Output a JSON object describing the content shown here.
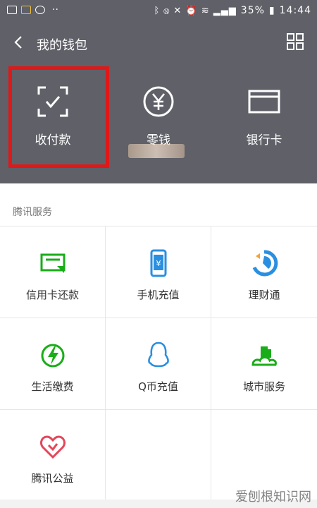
{
  "status_bar": {
    "battery": "35%",
    "time": "14:44",
    "dots": "··",
    "icons": [
      "image-icon",
      "account-icon",
      "wechat-icon",
      "bluetooth-icon",
      "nfc-icon",
      "mute-icon",
      "alarm-icon",
      "wifi-icon",
      "signal-icon",
      "battery-icon"
    ]
  },
  "header": {
    "title": "我的钱包",
    "back_icon": "chevron-left-icon",
    "menu_icon": "grid-icon"
  },
  "wallet_actions": [
    {
      "label": "收付款",
      "icon": "scan-check-icon"
    },
    {
      "label": "零钱",
      "icon": "yuan-circle-icon"
    },
    {
      "label": "银行卡",
      "icon": "card-icon"
    }
  ],
  "services": {
    "title": "腾讯服务",
    "items": [
      {
        "label": "信用卡还款",
        "icon": "credit-card-repay-icon"
      },
      {
        "label": "手机充值",
        "icon": "phone-recharge-icon"
      },
      {
        "label": "理财通",
        "icon": "wealth-icon"
      },
      {
        "label": "生活缴费",
        "icon": "utility-bill-icon"
      },
      {
        "label": "Q币充值",
        "icon": "qq-penguin-icon"
      },
      {
        "label": "城市服务",
        "icon": "city-service-icon"
      },
      {
        "label": "腾讯公益",
        "icon": "charity-heart-icon"
      }
    ]
  },
  "watermark": "爱刨根知识网",
  "colors": {
    "header_bg": "#5f6068",
    "accent_green": "#1aad19",
    "highlight_red": "#e01818",
    "icon_blue": "#2a8fe0",
    "charity_red": "#e5465a"
  }
}
